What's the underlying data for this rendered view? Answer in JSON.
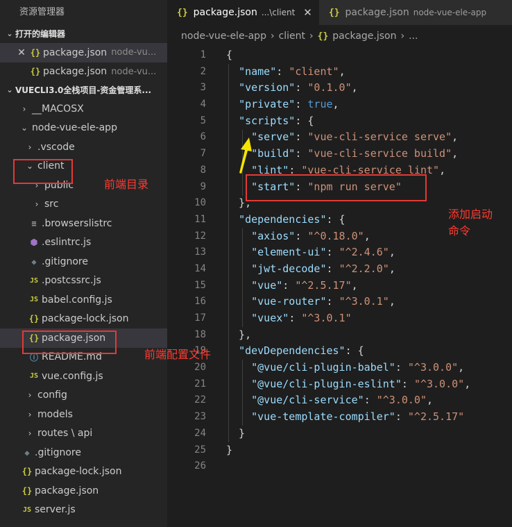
{
  "sidebar": {
    "title": "资源管理器",
    "open_editors": {
      "label": "打开的编辑器",
      "items": [
        {
          "name": "package.json",
          "desc": "node-vu..."
        },
        {
          "name": "package.json",
          "desc": "node-vu..."
        }
      ]
    },
    "project": {
      "label": "VUECLI3.0全栈项目-资金管理系...",
      "tree": [
        {
          "label": "__MACOSX",
          "icon": "chevron-right"
        },
        {
          "label": "node-vue-ele-app",
          "icon": "chevron-down"
        },
        {
          "label": ".vscode",
          "icon": "chevron-right"
        },
        {
          "label": "client",
          "icon": "chevron-down"
        },
        {
          "label": "public",
          "icon": "chevron-right"
        },
        {
          "label": "src",
          "icon": "chevron-right"
        },
        {
          "label": ".browserslistrc",
          "icon": "lines-icon"
        },
        {
          "label": ".eslintrc.js",
          "icon": "eslint-icon"
        },
        {
          "label": ".gitignore",
          "icon": "git-icon"
        },
        {
          "label": ".postcssrc.js",
          "icon": "js-icon"
        },
        {
          "label": "babel.config.js",
          "icon": "js-icon"
        },
        {
          "label": "package-lock.json",
          "icon": "json-icon"
        },
        {
          "label": "package.json",
          "icon": "json-icon"
        },
        {
          "label": "README.md",
          "icon": "info-icon"
        },
        {
          "label": "vue.config.js",
          "icon": "js-icon"
        },
        {
          "label": "config",
          "icon": "chevron-right"
        },
        {
          "label": "models",
          "icon": "chevron-right"
        },
        {
          "label": "routes \\ api",
          "icon": "chevron-right"
        },
        {
          "label": ".gitignore",
          "icon": "git-icon"
        },
        {
          "label": "package-lock.json",
          "icon": "json-icon"
        },
        {
          "label": "package.json",
          "icon": "json-icon"
        },
        {
          "label": "server.js",
          "icon": "js-icon"
        }
      ]
    }
  },
  "tabs": [
    {
      "name": "package.json",
      "desc": "...\\client",
      "active": true
    },
    {
      "name": "package.json",
      "desc": "node-vue-ele-app",
      "active": false
    }
  ],
  "breadcrumb": {
    "parts": [
      "node-vue-ele-app",
      "client",
      "package.json",
      "..."
    ]
  },
  "editor": {
    "line_numbers": [
      "1",
      "2",
      "3",
      "4",
      "5",
      "6",
      "7",
      "8",
      "9",
      "10",
      "11",
      "12",
      "13",
      "14",
      "15",
      "16",
      "17",
      "18",
      "19",
      "20",
      "21",
      "22",
      "23",
      "24",
      "25",
      "26"
    ],
    "lines": [
      [
        [
          "p",
          "{"
        ]
      ],
      [
        [
          "p",
          "  "
        ],
        [
          "k",
          "\"name\""
        ],
        [
          "p",
          ": "
        ],
        [
          "s",
          "\"client\""
        ],
        [
          "p",
          ","
        ]
      ],
      [
        [
          "p",
          "  "
        ],
        [
          "k",
          "\"version\""
        ],
        [
          "p",
          ": "
        ],
        [
          "s",
          "\"0.1.0\""
        ],
        [
          "p",
          ","
        ]
      ],
      [
        [
          "p",
          "  "
        ],
        [
          "k",
          "\"private\""
        ],
        [
          "p",
          ": "
        ],
        [
          "b",
          "true"
        ],
        [
          "p",
          ","
        ]
      ],
      [
        [
          "p",
          "  "
        ],
        [
          "k",
          "\"scripts\""
        ],
        [
          "p",
          ": {"
        ]
      ],
      [
        [
          "p",
          "    "
        ],
        [
          "k",
          "\"serve\""
        ],
        [
          "p",
          ": "
        ],
        [
          "s",
          "\"vue-cli-service serve\""
        ],
        [
          "p",
          ","
        ]
      ],
      [
        [
          "p",
          "    "
        ],
        [
          "k",
          "\"build\""
        ],
        [
          "p",
          ": "
        ],
        [
          "s",
          "\"vue-cli-service build\""
        ],
        [
          "p",
          ","
        ]
      ],
      [
        [
          "p",
          "    "
        ],
        [
          "k",
          "\"lint\""
        ],
        [
          "p",
          ": "
        ],
        [
          "s",
          "\"vue-cli-service lint\""
        ],
        [
          "p",
          ","
        ]
      ],
      [
        [
          "p",
          "    "
        ],
        [
          "k",
          "\"start\""
        ],
        [
          "p",
          ": "
        ],
        [
          "s",
          "\"npm run serve\""
        ]
      ],
      [
        [
          "p",
          "  },"
        ]
      ],
      [
        [
          "p",
          "  "
        ],
        [
          "k",
          "\"dependencies\""
        ],
        [
          "p",
          ": {"
        ]
      ],
      [
        [
          "p",
          "    "
        ],
        [
          "k",
          "\"axios\""
        ],
        [
          "p",
          ": "
        ],
        [
          "s",
          "\"^0.18.0\""
        ],
        [
          "p",
          ","
        ]
      ],
      [
        [
          "p",
          "    "
        ],
        [
          "k",
          "\"element-ui\""
        ],
        [
          "p",
          ": "
        ],
        [
          "s",
          "\"^2.4.6\""
        ],
        [
          "p",
          ","
        ]
      ],
      [
        [
          "p",
          "    "
        ],
        [
          "k",
          "\"jwt-decode\""
        ],
        [
          "p",
          ": "
        ],
        [
          "s",
          "\"^2.2.0\""
        ],
        [
          "p",
          ","
        ]
      ],
      [
        [
          "p",
          "    "
        ],
        [
          "k",
          "\"vue\""
        ],
        [
          "p",
          ": "
        ],
        [
          "s",
          "\"^2.5.17\""
        ],
        [
          "p",
          ","
        ]
      ],
      [
        [
          "p",
          "    "
        ],
        [
          "k",
          "\"vue-router\""
        ],
        [
          "p",
          ": "
        ],
        [
          "s",
          "\"^3.0.1\""
        ],
        [
          "p",
          ","
        ]
      ],
      [
        [
          "p",
          "    "
        ],
        [
          "k",
          "\"vuex\""
        ],
        [
          "p",
          ": "
        ],
        [
          "s",
          "\"^3.0.1\""
        ]
      ],
      [
        [
          "p",
          "  },"
        ]
      ],
      [
        [
          "p",
          "  "
        ],
        [
          "k",
          "\"devDependencies\""
        ],
        [
          "p",
          ": {"
        ]
      ],
      [
        [
          "p",
          "    "
        ],
        [
          "k",
          "\"@vue/cli-plugin-babel\""
        ],
        [
          "p",
          ": "
        ],
        [
          "s",
          "\"^3.0.0\""
        ],
        [
          "p",
          ","
        ]
      ],
      [
        [
          "p",
          "    "
        ],
        [
          "k",
          "\"@vue/cli-plugin-eslint\""
        ],
        [
          "p",
          ": "
        ],
        [
          "s",
          "\"^3.0.0\""
        ],
        [
          "p",
          ","
        ]
      ],
      [
        [
          "p",
          "    "
        ],
        [
          "k",
          "\"@vue/cli-service\""
        ],
        [
          "p",
          ": "
        ],
        [
          "s",
          "\"^3.0.0\""
        ],
        [
          "p",
          ","
        ]
      ],
      [
        [
          "p",
          "    "
        ],
        [
          "k",
          "\"vue-template-compiler\""
        ],
        [
          "p",
          ": "
        ],
        [
          "s",
          "\"^2.5.17\""
        ]
      ],
      [
        [
          "p",
          "  }"
        ]
      ],
      [
        [
          "p",
          "}"
        ]
      ],
      [
        [
          "p",
          ""
        ]
      ]
    ]
  },
  "annotations": {
    "frontend_dir": "前端目录",
    "frontend_config": "前端配置文件",
    "add_start_line1": "添加启动",
    "add_start_line2": "命令"
  },
  "colors": {
    "annotation": "#ff3b30",
    "box": "#e53935",
    "arrow": "#f5e400"
  }
}
